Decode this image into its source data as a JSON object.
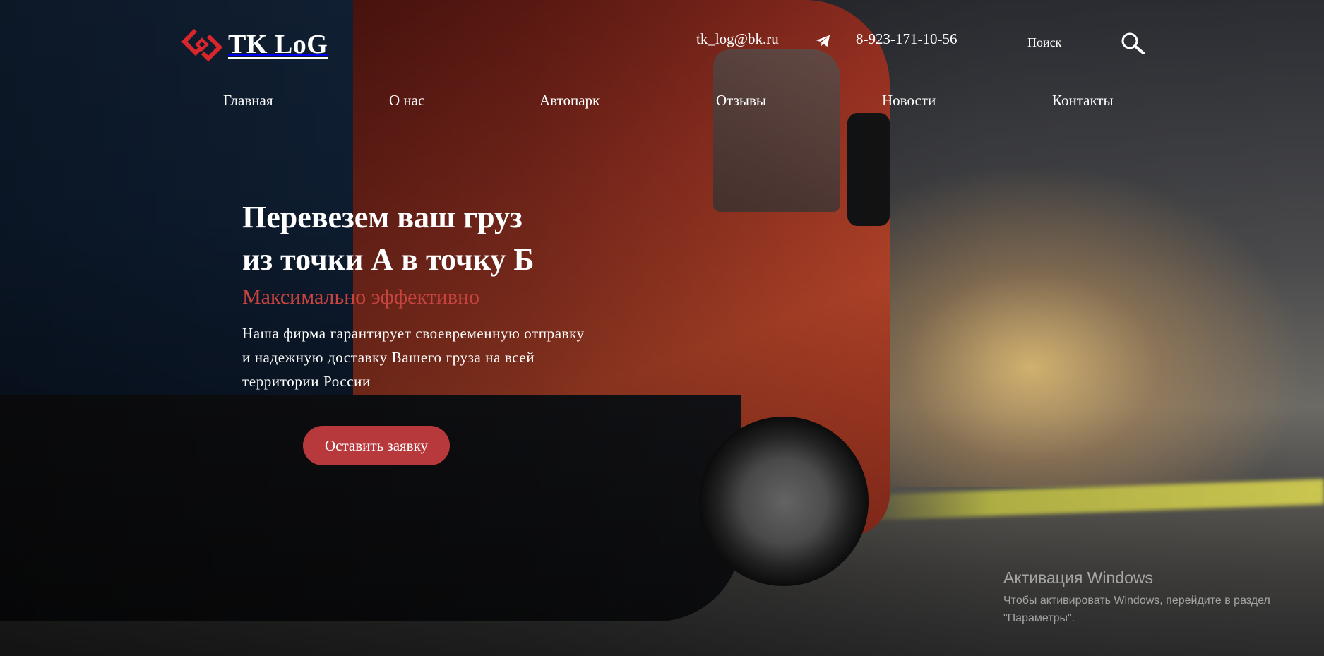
{
  "brand": {
    "name": "TK LoG",
    "colors": {
      "accent": "#b8393c",
      "subtitle": "#c9443f",
      "logo_red": "#d8262b"
    }
  },
  "header": {
    "email": "tk_log@bk.ru",
    "telegram_icon": "telegram-icon",
    "phone": "8-923-171-10-56",
    "search": {
      "placeholder": "Поиск",
      "value": "",
      "icon": "search-icon"
    }
  },
  "nav": {
    "items": [
      {
        "label": "Главная"
      },
      {
        "label": "О нас"
      },
      {
        "label": "Автопарк"
      },
      {
        "label": "Отзывы"
      },
      {
        "label": "Новости"
      },
      {
        "label": "Контакты"
      }
    ]
  },
  "hero": {
    "title_line1": "Перевезем ваш груз",
    "title_line2": "из точки А в точку Б",
    "subtitle": "Максимально эффективно",
    "text": "Наша фирма гарантирует своевременную отправку и надежную доставку Вашего груза на всей территории России",
    "cta_label": "Оставить заявку"
  },
  "os_watermark": {
    "title": "Активация Windows",
    "text": "Чтобы активировать Windows, перейдите в раздел \"Параметры\"."
  }
}
